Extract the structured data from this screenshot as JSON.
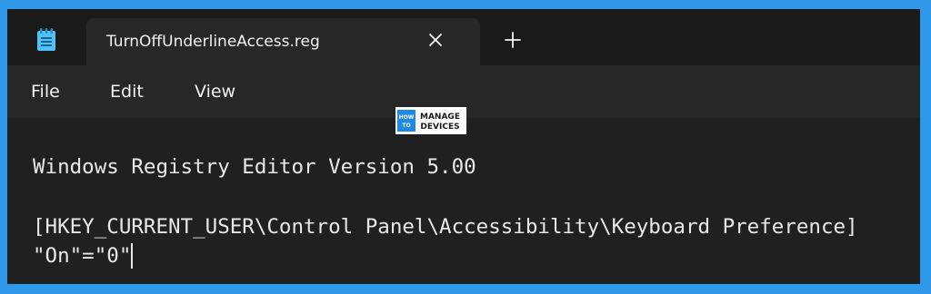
{
  "tab": {
    "title": "TurnOffUnderlineAccess.reg"
  },
  "menu": {
    "items": [
      {
        "label": "File"
      },
      {
        "label": "Edit"
      },
      {
        "label": "View"
      }
    ]
  },
  "logo": {
    "line_how": "HOW",
    "line_to": "TO",
    "line_manage": "MANAGE",
    "line_devices": "DEVICES"
  },
  "editor": {
    "lines": [
      "Windows Registry Editor Version 5.00",
      "",
      "[HKEY_CURRENT_USER\\Control Panel\\Accessibility\\Keyboard Preference]",
      "\"On\"=\"0\""
    ]
  },
  "icons": {
    "app": "notepad-icon",
    "close": "close-icon",
    "new_tab": "plus-icon"
  },
  "colors": {
    "frame_border": "#2f98e8",
    "titlebar": "#1a1a1a",
    "tab": "#272727",
    "editor_bg": "#202020",
    "text": "#e8e8e8",
    "app_icon": "#4fc3f7"
  }
}
